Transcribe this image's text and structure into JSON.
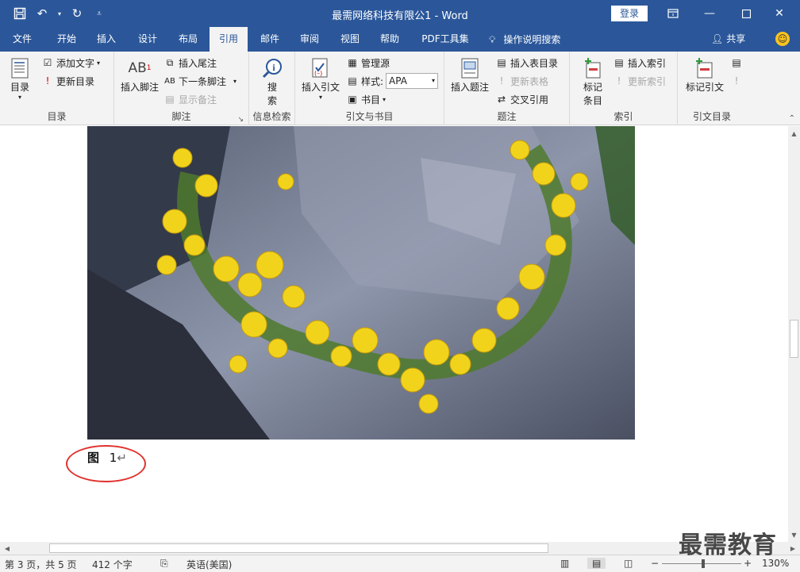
{
  "app": {
    "title": "最需网络科技有限公1  -  Word",
    "login_label": "登录"
  },
  "tabs": [
    "文件",
    "开始",
    "插入",
    "设计",
    "布局",
    "引用",
    "邮件",
    "审阅",
    "视图",
    "帮助",
    "PDF工具集"
  ],
  "active_tab": "引用",
  "tell_me": "操作说明搜索",
  "share_label": "共享",
  "ribbon": {
    "toc": {
      "toc_label": "目录",
      "add_text": "添加文字",
      "update_toc": "更新目录",
      "group": "目录"
    },
    "footnotes": {
      "insert_footnote": "插入脚注",
      "insert_endnote": "插入尾注",
      "next_footnote": "下一条脚注",
      "show_notes": "显示备注",
      "group": "脚注"
    },
    "research": {
      "search": "搜\n索",
      "search_line1": "搜",
      "search_line2": "索",
      "group": "信息检索"
    },
    "citations": {
      "insert_citation": "插入引文",
      "manage_sources": "管理源",
      "style_label": "样式:",
      "style_value": "APA",
      "bibliography": "书目",
      "group": "引文与书目"
    },
    "captions": {
      "insert_caption": "插入题注",
      "insert_table_of_figures": "插入表目录",
      "update_table": "更新表格",
      "cross_reference": "交叉引用",
      "group": "题注"
    },
    "index": {
      "mark_entry_line1": "标记",
      "mark_entry_line2": "条目",
      "insert_index": "插入索引",
      "update_index": "更新索引",
      "group": "索引"
    },
    "toa": {
      "mark_citation": "标记引文",
      "group": "引文目录"
    }
  },
  "document": {
    "caption_label": "图",
    "caption_number": "1",
    "paragraph_mark": "↵"
  },
  "status": {
    "page": "第 3 页，共 5 页",
    "words": "412 个字",
    "language": "英语(美国)",
    "zoom": "130%"
  },
  "watermark": "最需教育",
  "colors": {
    "brand": "#2b579a",
    "caption_circle": "#e0322d"
  }
}
